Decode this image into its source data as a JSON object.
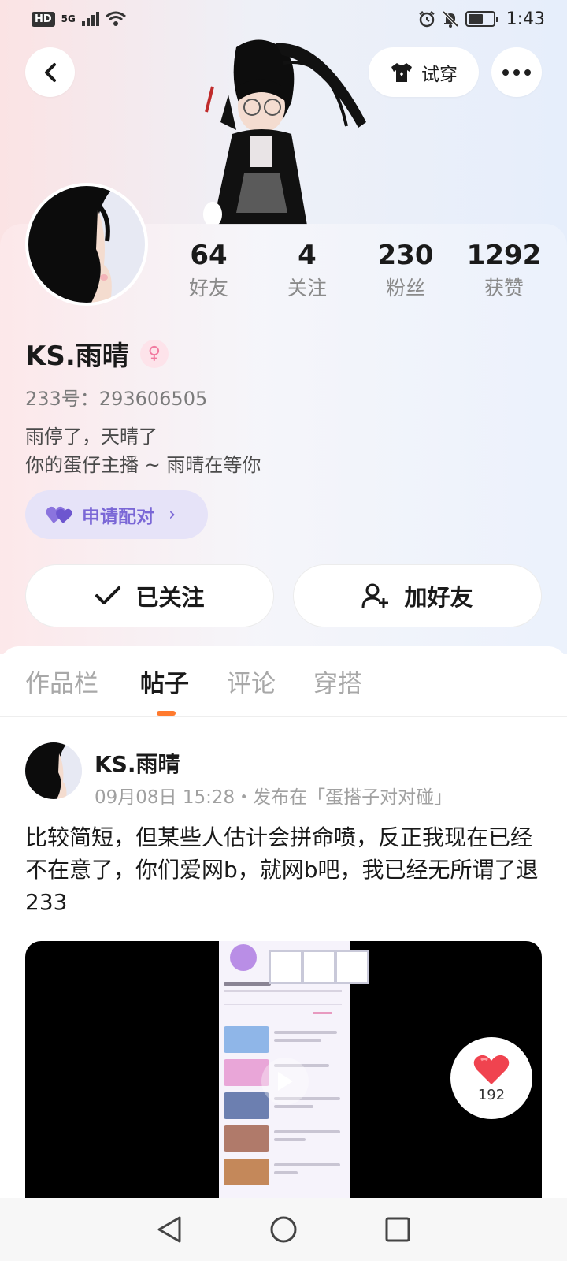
{
  "status_bar": {
    "network_badge": "HD",
    "network_type": "5G",
    "time": "1:43",
    "icons": [
      "signal-icon",
      "wifi-icon",
      "alarm-icon",
      "mute-bell-icon",
      "battery-icon"
    ]
  },
  "header": {
    "try_on_label": "试穿",
    "icons": [
      "back-arrow-icon",
      "shirt-icon",
      "more-dots-icon"
    ]
  },
  "profile": {
    "stats": [
      {
        "value": "64",
        "label": "好友"
      },
      {
        "value": "4",
        "label": "关注"
      },
      {
        "value": "230",
        "label": "粉丝"
      },
      {
        "value": "1292",
        "label": "获赞"
      }
    ],
    "username": "KS.雨晴",
    "gender": "female",
    "id_text": "233号：293606505",
    "bio_line1": "雨停了，天晴了",
    "bio_line2": "你的蛋仔主播 ~ 雨晴在等你",
    "pair_label": "申请配对",
    "follow_label": "已关注",
    "add_friend_label": "加好友"
  },
  "tabs": [
    {
      "label": "作品栏",
      "active": false
    },
    {
      "label": "帖子",
      "active": true
    },
    {
      "label": "评论",
      "active": false
    },
    {
      "label": "穿搭",
      "active": false
    }
  ],
  "post": {
    "author": "KS.雨晴",
    "meta": "09月08日 15:28・发布在「蛋搭子对对碰」",
    "text": "比较简短，但某些人估计会拼命喷，反正我现在已经不在意了，你们爱网b，就网b吧，我已经无所谓了退233",
    "likes": "192"
  },
  "colors": {
    "accent_orange": "#ff7a2e",
    "pair_purple": "#7a67d6",
    "heart_red": "#f0434f",
    "female_pink": "#f17aa0"
  }
}
